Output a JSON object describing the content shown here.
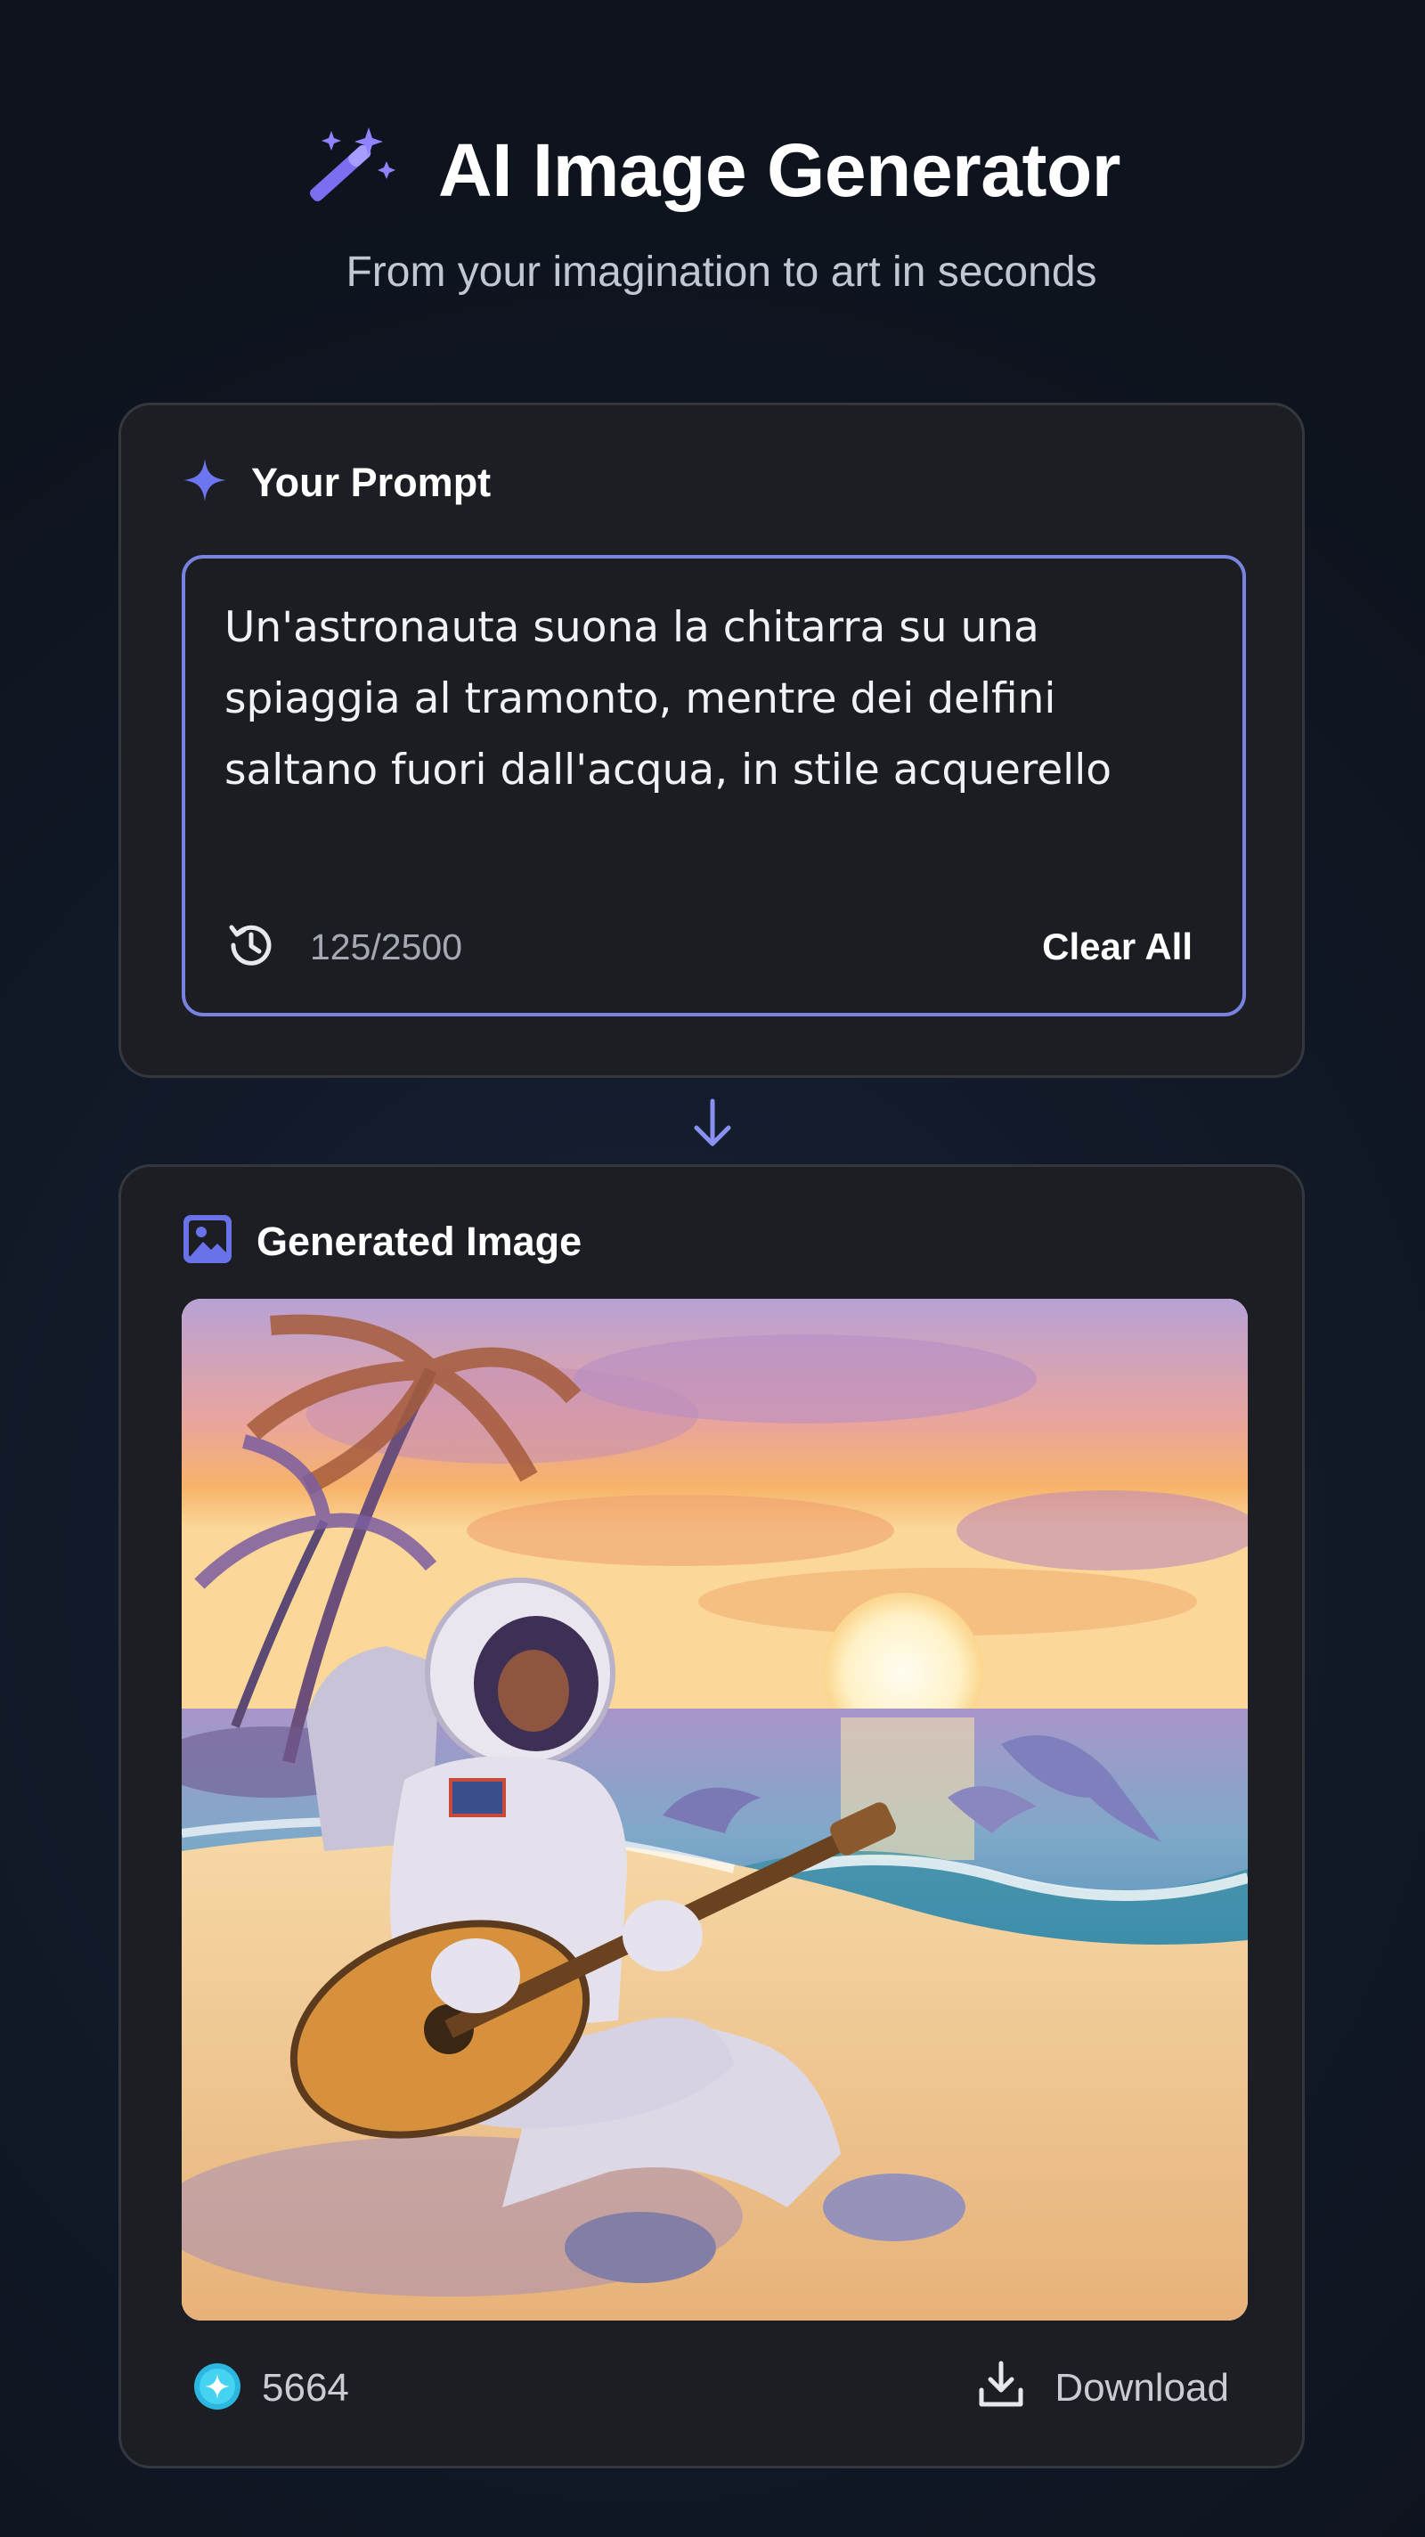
{
  "app": {
    "title": "AI Image Generator",
    "subtitle": "From your imagination to art in seconds",
    "accent_color": "#7883e0"
  },
  "prompt_card": {
    "label": "Your Prompt",
    "icon": "sparkle-icon",
    "value": "Un'astronauta suona la chitarra su una spiaggia al tramonto, mentre dei delfini saltano fuori dall'acqua, in stile acquerello",
    "counter": "125/2500",
    "history_icon": "history-icon",
    "clear_label": "Clear All"
  },
  "image_card": {
    "label": "Generated Image",
    "icon": "image-icon",
    "image_description": "Watercolor painting of an astronaut in a white spacesuit sitting on a beach playing an acoustic guitar at sunset, with palm trees on the left and dolphins leaping out of the sea",
    "credits": "5664",
    "credits_icon": "credit-token-icon",
    "download_label": "Download",
    "download_icon": "download-icon"
  }
}
